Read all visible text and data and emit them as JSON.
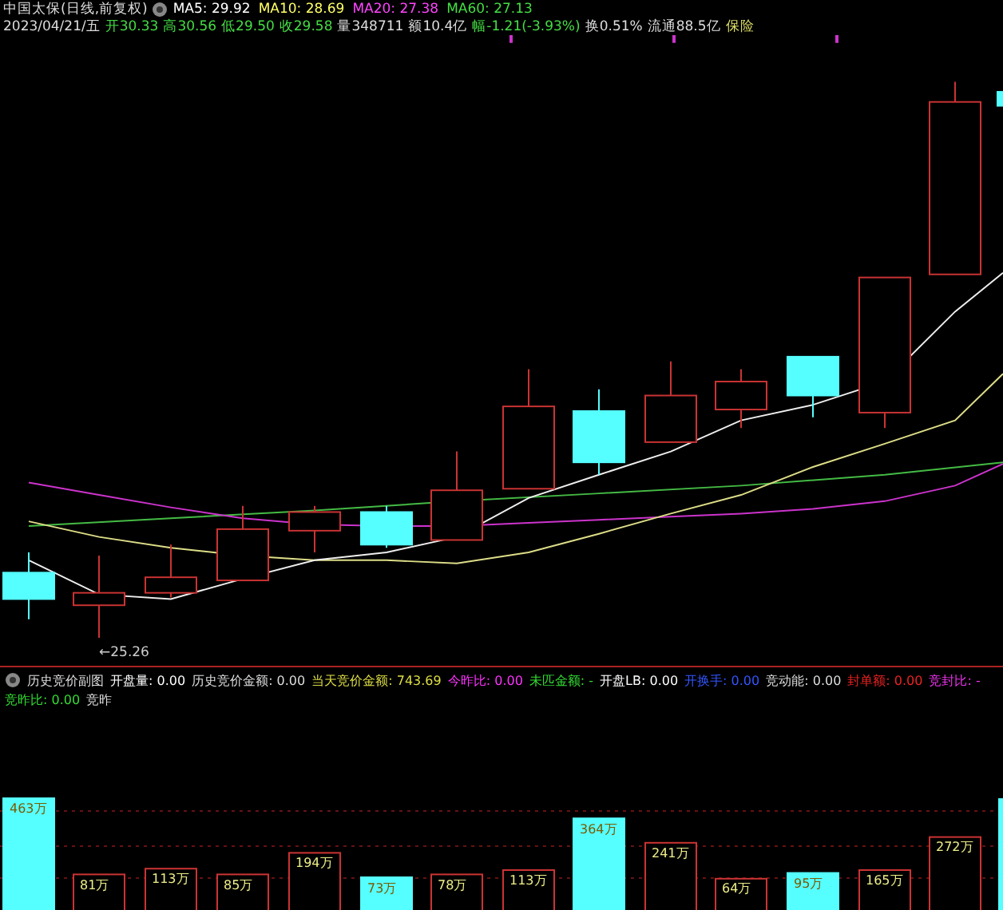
{
  "header": {
    "title": "中国太保(日线,前复权)",
    "ma_legend": [
      {
        "text": "MA5: 29.92",
        "color": "#ffffff"
      },
      {
        "text": "MA10: 28.69",
        "color": "#ffff66"
      },
      {
        "text": "MA20: 27.38",
        "color": "#ff44ff"
      },
      {
        "text": "MA60: 27.13",
        "color": "#44dd44"
      }
    ],
    "quote": [
      {
        "text": "2023/04/21/五",
        "color": "#dddddd"
      },
      {
        "text": "开30.33",
        "color": "#44dd44"
      },
      {
        "text": "高30.56",
        "color": "#44dd44"
      },
      {
        "text": "低29.50",
        "color": "#44dd44"
      },
      {
        "text": "收29.58",
        "color": "#44dd44"
      },
      {
        "text": "量348711",
        "color": "#dddddd"
      },
      {
        "text": "额10.4亿",
        "color": "#dddddd"
      },
      {
        "text": "幅-1.21(-3.93%)",
        "color": "#44dd44"
      },
      {
        "text": "换0.51%",
        "color": "#dddddd"
      },
      {
        "text": "流通88.5亿",
        "color": "#dddddd"
      },
      {
        "text": "保险",
        "color": "#dddd66"
      }
    ]
  },
  "main_chart": {
    "low_marker": "←25.26"
  },
  "indicator_bar": {
    "title": "历史竞价副图",
    "items": [
      {
        "text": "开盘量: 0.00",
        "color": "#ffffff"
      },
      {
        "text": "历史竞价金额: 0.00",
        "color": "#dddddd"
      },
      {
        "text": "当天竞价金额: 743.69",
        "color": "#dddd44"
      },
      {
        "text": "今昨比: 0.00",
        "color": "#ff33ff"
      },
      {
        "text": "未匹金额: -",
        "color": "#33dd33"
      },
      {
        "text": "开盘LB: 0.00",
        "color": "#ffffff"
      },
      {
        "text": "开换手: 0.00",
        "color": "#3355ff"
      },
      {
        "text": "竞动能: 0.00",
        "color": "#dddddd"
      },
      {
        "text": "封单额: 0.00",
        "color": "#ee2222"
      },
      {
        "text": "竞封比: -",
        "color": "#ee33ee"
      },
      {
        "text": "竞昨比: 0.00",
        "color": "#33dd33"
      },
      {
        "text": "竞昨",
        "color": "#dddddd"
      }
    ]
  },
  "volume_labels": [
    "463万",
    "81万",
    "113万",
    "85万",
    "194万",
    "73万",
    "78万",
    "113万",
    "364万",
    "241万",
    "64万",
    "95万",
    "165万",
    "272万"
  ]
}
